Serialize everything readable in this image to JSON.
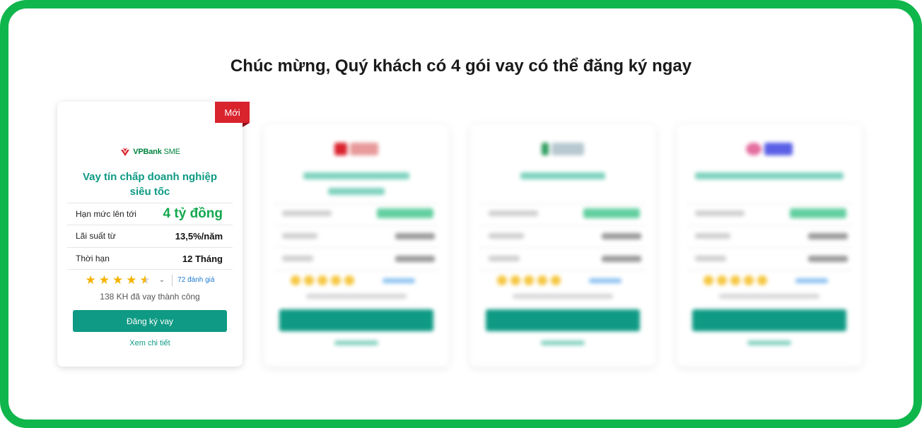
{
  "heading": "Chúc mừng, Quý khách có 4 gói vay có thể đăng ký ngay",
  "featured_card": {
    "badge": "Mới",
    "logo_brand": "VPBank",
    "logo_suffix": "SME",
    "title_line1": "Vay tín chấp doanh nghiệp",
    "title_line2": "siêu tốc",
    "rows": [
      {
        "label": "Hạn mức lên tới",
        "value": "4 tỷ đồng"
      },
      {
        "label": "Lãi suất từ",
        "value": "13,5%/năm"
      },
      {
        "label": "Thời hạn",
        "value": "12 Tháng"
      }
    ],
    "rating": 4.5,
    "reviews_label": "72 đánh giá",
    "success_count": "138 KH đã vay thành công",
    "apply_button": "Đăng ký vay",
    "details_link": "Xem chi tiết"
  },
  "colors": {
    "frame": "#0fb64b",
    "accent": "#0e9a84",
    "badge": "#d9232d",
    "star": "#f5b301",
    "link": "#1e7bd1"
  },
  "blurred_cards_count": 3
}
